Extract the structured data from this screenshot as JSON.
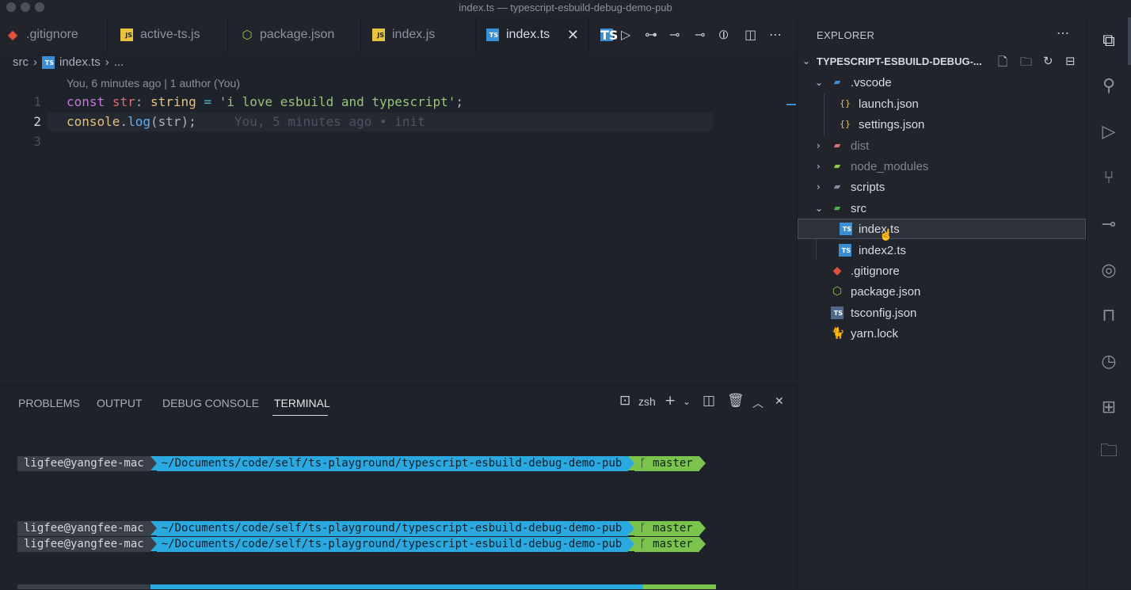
{
  "window": {
    "title": "index.ts — typescript-esbuild-debug-demo-pub"
  },
  "tabs": [
    {
      "label": ".gitignore",
      "icon": "git-icon"
    },
    {
      "label": "active-ts.js",
      "icon": "js-file-icon"
    },
    {
      "label": "package.json",
      "icon": "nodejs-icon"
    },
    {
      "label": "index.js",
      "icon": "js-file-icon"
    },
    {
      "label": "index.ts",
      "icon": "ts-file-icon",
      "active": true
    }
  ],
  "file_icon_text": {
    "js": "JS",
    "ts": "TS"
  },
  "breadcrumb": {
    "folder": "src",
    "file": "index.ts",
    "ellipsis": "..."
  },
  "blame_header": "You, 6 minutes ago | 1 author (You)",
  "editor": {
    "line_numbers": [
      "1",
      "2",
      "3"
    ],
    "line1": {
      "kw": "const",
      "var": "str",
      "colon": ":",
      "type": "string",
      "eq": "=",
      "str": "'i love esbuild and typescript'",
      "semi": ";"
    },
    "line2": {
      "obj": "console",
      "dot": ".",
      "fn": "log",
      "args": "(str);",
      "blame": "You, 5 minutes ago • init"
    }
  },
  "panel": {
    "tabs": [
      "PROBLEMS",
      "OUTPUT",
      "DEBUG CONSOLE",
      "TERMINAL"
    ],
    "active_tab": "TERMINAL",
    "shell": "zsh"
  },
  "terminal": {
    "prompts": [
      {
        "user": "ligfee@yangfee-mac",
        "path": "~/Documents/code/self/ts-playground/typescript-esbuild-debug-demo-pub",
        "branch": "master"
      },
      {
        "user": "ligfee@yangfee-mac",
        "path": "~/Documents/code/self/ts-playground/typescript-esbuild-debug-demo-pub",
        "branch": "master"
      },
      {
        "user": "ligfee@yangfee-mac",
        "path": "~/Documents/code/self/ts-playground/typescript-esbuild-debug-demo-pub",
        "branch": "master"
      }
    ],
    "branch_glyph": "ᚴ"
  },
  "explorer": {
    "title": "EXPLORER",
    "folder": "TYPESCRIPT-ESBUILD-DEBUG-...",
    "tree": [
      {
        "label": ".vscode",
        "type": "folder",
        "expanded": true
      },
      {
        "label": "launch.json",
        "type": "json"
      },
      {
        "label": "settings.json",
        "type": "json"
      },
      {
        "label": "dist",
        "type": "folder",
        "expanded": false
      },
      {
        "label": "node_modules",
        "type": "folder",
        "expanded": false
      },
      {
        "label": "scripts",
        "type": "folder",
        "expanded": false
      },
      {
        "label": "src",
        "type": "folder",
        "expanded": true
      },
      {
        "label": "index.ts",
        "type": "ts",
        "selected": true
      },
      {
        "label": "index2.ts",
        "type": "ts"
      },
      {
        "label": ".gitignore",
        "type": "git"
      },
      {
        "label": "package.json",
        "type": "node"
      },
      {
        "label": "tsconfig.json",
        "type": "tsconfig"
      },
      {
        "label": "yarn.lock",
        "type": "yarn"
      }
    ]
  },
  "colors": {
    "ts": "#3b8ed4",
    "js": "#e8c33d",
    "path_segment": "#2aa8e0",
    "git_segment": "#7cc34e"
  }
}
